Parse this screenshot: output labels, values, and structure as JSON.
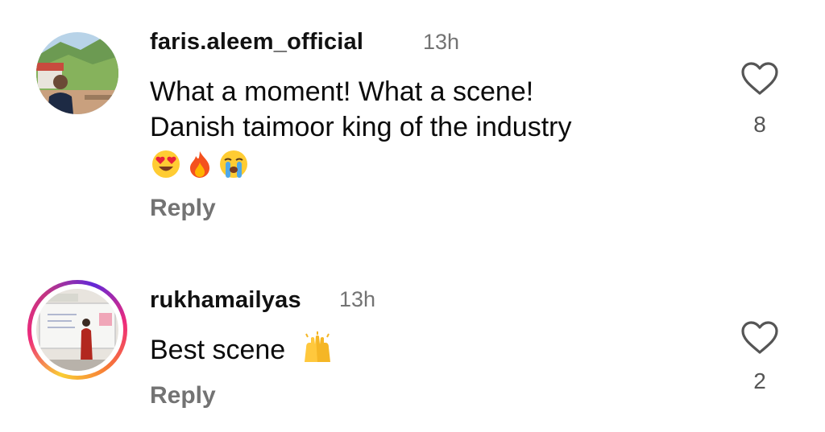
{
  "comments": [
    {
      "username": "faris.aleem_official",
      "time": "13h",
      "text_line1": "What a moment! What a scene!",
      "text_line2": "Danish taimoor king of the industry",
      "emojis": [
        "heart-eyes-emoji",
        "fire-emoji",
        "loudly-crying-emoji"
      ],
      "reply_label": "Reply",
      "like_count": "8"
    },
    {
      "username": "rukhamailyas",
      "time": "13h",
      "text": "Best scene",
      "emoji": "raising-hands-emoji",
      "reply_label": "Reply",
      "like_count": "2"
    }
  ],
  "colors": {
    "text": "#0b0b0b",
    "muted": "#737373",
    "story_ring": [
      "#f9ce34",
      "#ee2a7b",
      "#6228d7"
    ]
  },
  "icons": {
    "like": "heart-outline-icon"
  }
}
